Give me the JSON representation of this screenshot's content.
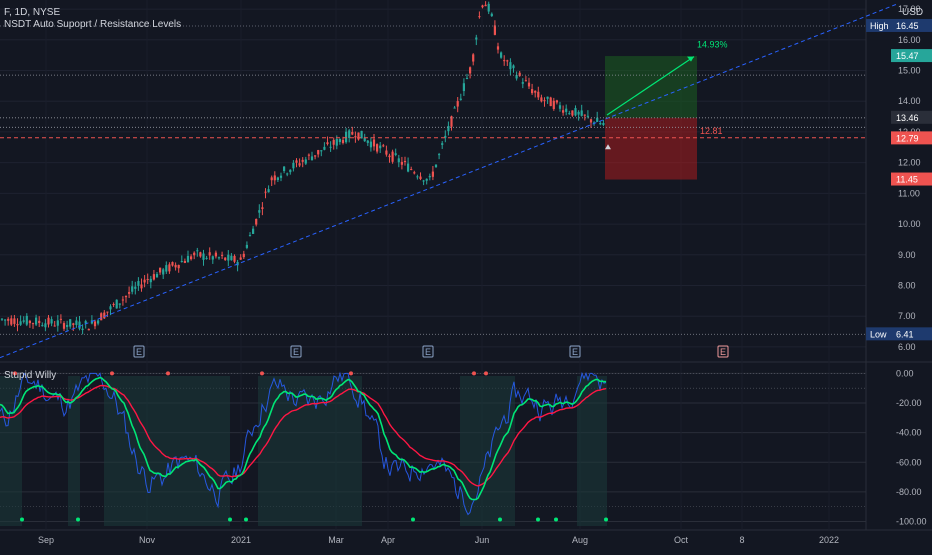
{
  "header": {
    "symbol_line": "F, 1D, NYSE",
    "indicator_1": "NSDT Auto Supoprt / Resistance Levels",
    "currency": "USD"
  },
  "lower_pane": {
    "title": "Stupid Willy"
  },
  "colors": {
    "background": "#131722",
    "up_candle": "#26a69a",
    "down_candle": "#ef5350",
    "trendline": "#2962ff",
    "wave_fast": "#2962ff",
    "wave_green": "#00e676",
    "wave_red": "#ff1744",
    "target_zone": "#1b5e20",
    "stop_zone": "#b71c1c"
  },
  "chart_data": {
    "type": "candlestick",
    "symbol": "F",
    "interval": "1D",
    "exchange": "NYSE",
    "currency": "USD",
    "price_axis": {
      "ticks": [
        "17.00",
        "16.00",
        "15.00",
        "14.00",
        "13.00",
        "12.00",
        "11.00",
        "10.00",
        "9.00",
        "8.00",
        "7.00",
        "6.00"
      ],
      "range": [
        5.9,
        17.1
      ]
    },
    "time_axis": {
      "ticks": [
        "Sep",
        "Nov",
        "2021",
        "Mar",
        "Apr",
        "Jun",
        "Aug",
        "Oct",
        "8",
        "2022"
      ]
    },
    "price_levels": [
      {
        "name": "High",
        "value": "16.45"
      },
      {
        "name": "Low",
        "value": "6.41"
      }
    ],
    "price_tags": [
      {
        "value": "15.47",
        "kind": "target"
      },
      {
        "value": "13.46",
        "kind": "entry"
      },
      {
        "value": "12.79",
        "kind": "last"
      },
      {
        "value": "11.45",
        "kind": "stop"
      }
    ],
    "annotations": {
      "target_pct": "14.93%",
      "support_level": "12.81",
      "support_value": 12.81,
      "earnings_marker": "E"
    },
    "candles_sampled": [
      {
        "date": "Aug",
        "close": 6.9
      },
      {
        "date": "Sep",
        "close": 6.8
      },
      {
        "date": "Oct",
        "close": 6.7
      },
      {
        "date": "Nov",
        "close": 8.2
      },
      {
        "date": "Dec",
        "close": 9.0
      },
      {
        "date": "2021",
        "close": 8.8
      },
      {
        "date": "Jan",
        "close": 11.5
      },
      {
        "date": "Feb",
        "close": 12.0
      },
      {
        "date": "Mar",
        "close": 13.0
      },
      {
        "date": "Apr",
        "close": 12.3
      },
      {
        "date": "May",
        "close": 11.4
      },
      {
        "date": "Jun",
        "close": 16.1
      },
      {
        "date": "Jul",
        "close": 14.1
      },
      {
        "date": "Aug",
        "close": 13.2
      }
    ],
    "oscillator": {
      "name": "Stupid Willy",
      "ticks": [
        "0.00",
        "-20.00",
        "-40.00",
        "-60.00",
        "-80.00",
        "-100.00"
      ],
      "range": [
        -103,
        5
      ]
    }
  }
}
